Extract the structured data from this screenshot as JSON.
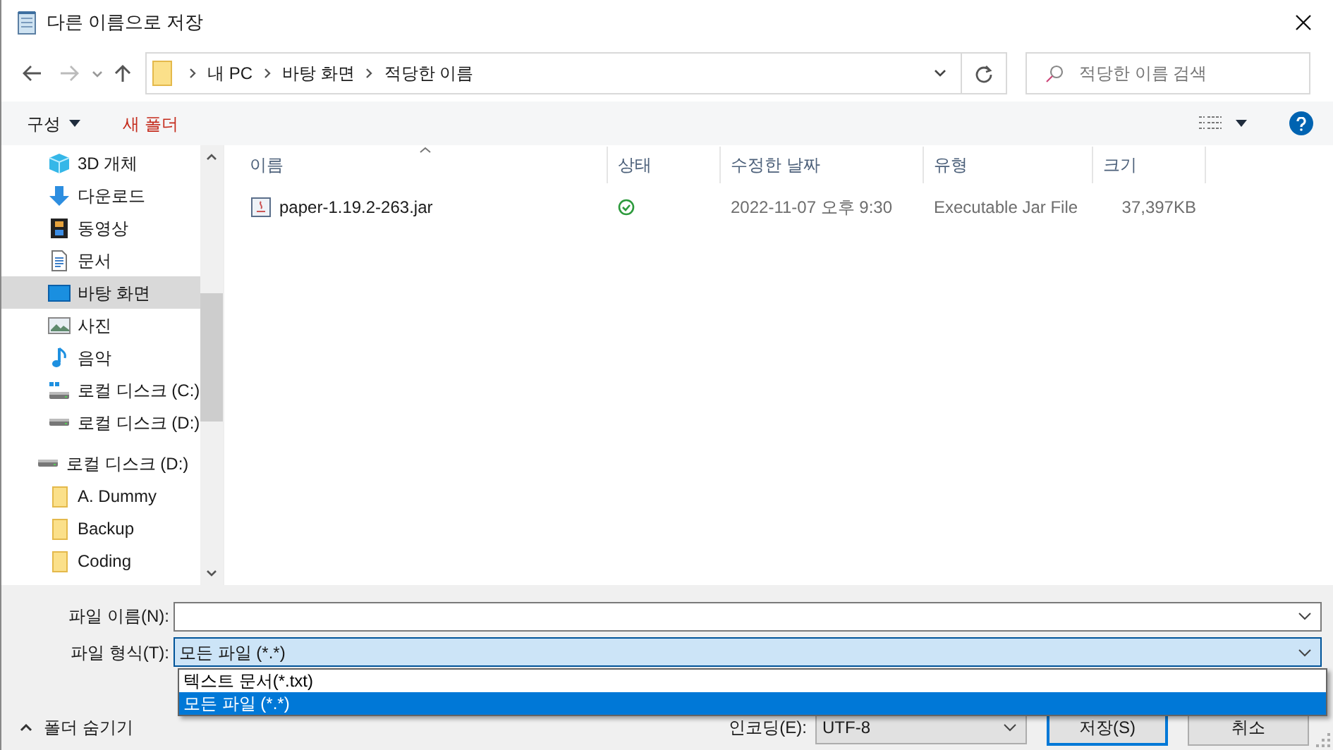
{
  "window": {
    "title": "다른 이름으로 저장"
  },
  "nav": {
    "back_disabled": false,
    "forward_disabled": true,
    "breadcrumb": [
      "내 PC",
      "바탕 화면",
      "적당한 이름"
    ],
    "search": {
      "placeholder": "적당한 이름 검색"
    }
  },
  "toolbar": {
    "organize": "구성",
    "new_folder": "새 폴더"
  },
  "sidebar": {
    "items": [
      {
        "label": "3D 개체",
        "kind": "cube",
        "selected": false
      },
      {
        "label": "다운로드",
        "kind": "download",
        "selected": false
      },
      {
        "label": "동영상",
        "kind": "video",
        "selected": false
      },
      {
        "label": "문서",
        "kind": "document",
        "selected": false
      },
      {
        "label": "바탕 화면",
        "kind": "desktop",
        "selected": true
      },
      {
        "label": "사진",
        "kind": "pictures",
        "selected": false
      },
      {
        "label": "음악",
        "kind": "music",
        "selected": false
      },
      {
        "label": "로컬 디스크 (C:)",
        "kind": "system-drive",
        "selected": false
      },
      {
        "label": "로컬 디스크 (D:)",
        "kind": "drive",
        "selected": false
      }
    ],
    "tree": {
      "label": "로컬 디스크 (D:)",
      "kind": "drive",
      "selected": false,
      "children": [
        {
          "label": "A. Dummy",
          "kind": "folder",
          "selected": false
        },
        {
          "label": "Backup",
          "kind": "folder",
          "selected": false
        },
        {
          "label": "Coding",
          "kind": "folder",
          "selected": false
        }
      ]
    }
  },
  "table": {
    "columns": [
      "이름",
      "상태",
      "수정한 날짜",
      "유형",
      "크기"
    ],
    "rows": [
      {
        "name": "paper-1.19.2-263.jar",
        "synced": true,
        "modified": "2022-11-07 오후 9:30",
        "type": "Executable Jar File",
        "size": "37,397KB"
      }
    ]
  },
  "form": {
    "file_name_label": "파일 이름(N):",
    "file_type_label": "파일 형식(T):",
    "file_type_value": "모든 파일 (*.*)",
    "file_type_options": [
      {
        "label": "텍스트 문서(*.txt)",
        "selected": false
      },
      {
        "label": "모든 파일 (*.*)",
        "selected": true
      }
    ],
    "hide_folders": "폴더 숨기기",
    "encoding_label": "인코딩(E):",
    "encoding_value": "UTF-8",
    "save": "저장(S)",
    "cancel": "취소"
  }
}
